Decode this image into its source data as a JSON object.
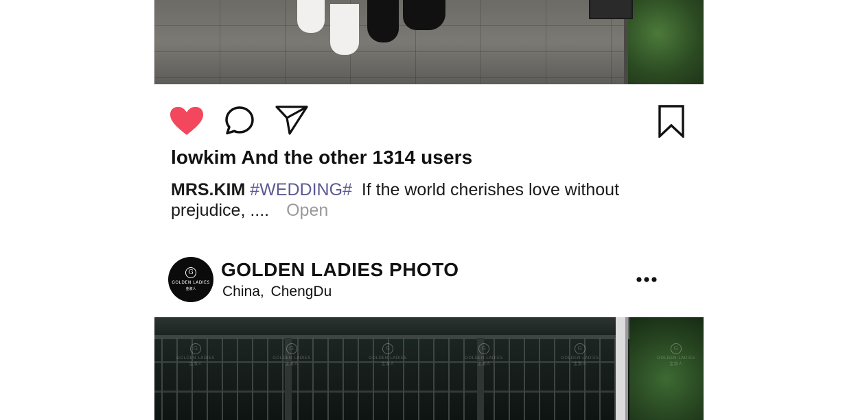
{
  "post_top": {
    "likes_text": "lowkim And the other 1314 users",
    "caption": {
      "author": "MRS.KIM",
      "hashtag": "#WEDDING#",
      "text_line1": "If the world cherishes love without",
      "text_line2": "prejudice, ....",
      "open_label": "Open"
    }
  },
  "actions": {
    "like_icon": "heart-icon",
    "comment_icon": "comment-icon",
    "share_icon": "share-icon",
    "save_icon": "bookmark-icon",
    "liked_color": "#f2475c"
  },
  "post_next": {
    "account_name": "GOLDEN LADIES PHOTO",
    "location_country": "China,",
    "location_city": "ChengDu",
    "menu_icon": "more-icon",
    "avatar": {
      "monogram": "G",
      "brand": "GOLDEN LADIES",
      "sub": "金淑人"
    },
    "watermark": {
      "monogram": "G",
      "brand": "GOLDEN LADIES",
      "sub": "金淑人"
    }
  }
}
